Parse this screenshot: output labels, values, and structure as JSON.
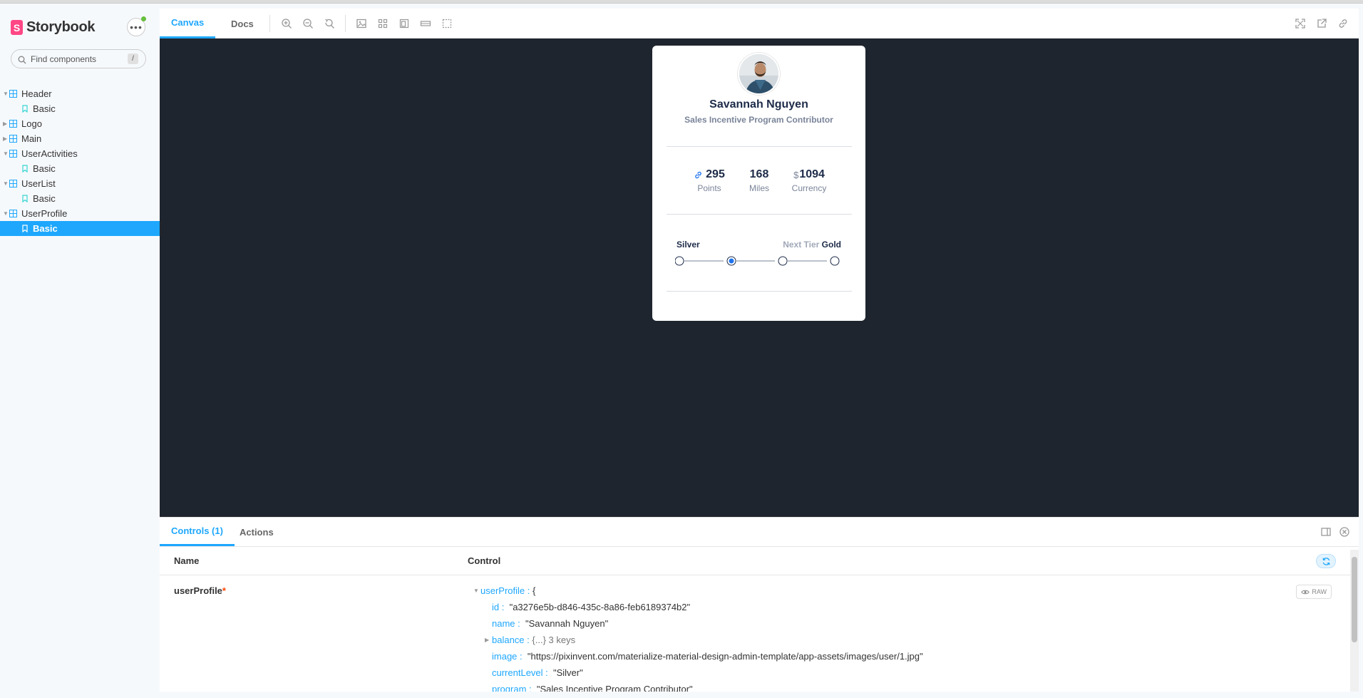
{
  "app": {
    "brand": "Storybook"
  },
  "search": {
    "placeholder": "Find components",
    "shortcut": "/"
  },
  "tree": [
    {
      "label": "Header",
      "type": "component",
      "expanded": true
    },
    {
      "label": "Basic",
      "type": "story"
    },
    {
      "label": "Logo",
      "type": "component",
      "expanded": false
    },
    {
      "label": "Main",
      "type": "component",
      "expanded": false
    },
    {
      "label": "UserActivities",
      "type": "component",
      "expanded": true
    },
    {
      "label": "Basic",
      "type": "story"
    },
    {
      "label": "UserList",
      "type": "component",
      "expanded": true
    },
    {
      "label": "Basic",
      "type": "story"
    },
    {
      "label": "UserProfile",
      "type": "component",
      "expanded": true
    },
    {
      "label": "Basic",
      "type": "story",
      "selected": true
    }
  ],
  "toolbar": {
    "tabs": [
      "Canvas",
      "Docs"
    ],
    "tools": [
      "zoom-in-icon",
      "zoom-out-icon",
      "zoom-reset-icon",
      "background-icon",
      "grid-icon",
      "viewport-icon",
      "measure-icon",
      "outline-icon"
    ],
    "right_tools": [
      "fullscreen-icon",
      "open-new-tab-icon",
      "copy-link-icon"
    ]
  },
  "card": {
    "name": "Savannah Nguyen",
    "role": "Sales Incentive Program Contributor",
    "stats": [
      {
        "value": "295",
        "label": "Points",
        "icon": "link-icon"
      },
      {
        "value": "168",
        "label": "Miles"
      },
      {
        "value": "1094",
        "label": "Currency",
        "prefix": "$"
      }
    ],
    "current_tier": "Silver",
    "next_tier_label": "Next Tier",
    "next_tier": "Gold",
    "steps_total": 4,
    "active_step": 2
  },
  "addons": {
    "tabs": [
      "Controls (1)",
      "Actions"
    ],
    "headers": {
      "name": "Name",
      "control": "Control"
    },
    "row": {
      "name": "userProfile",
      "required": "*"
    },
    "raw_label": "RAW",
    "object": {
      "root_key": "userProfile :",
      "root_open": "{",
      "id_key": "id :",
      "id_val": "\"a3276e5b-d846-435c-8a86-feb6189374b2\"",
      "name_key": "name :",
      "name_val": "\"Savannah Nguyen\"",
      "balance_key": "balance :",
      "balance_val": "{...} 3 keys",
      "image_key": "image :",
      "image_val": "\"https://pixinvent.com/materialize-material-design-admin-template/app-assets/images/user/1.jpg\"",
      "level_key": "currentLevel :",
      "level_val": "\"Silver\"",
      "program_key": "program :",
      "program_val": "\"Sales Incentive Program Contributor\""
    }
  }
}
